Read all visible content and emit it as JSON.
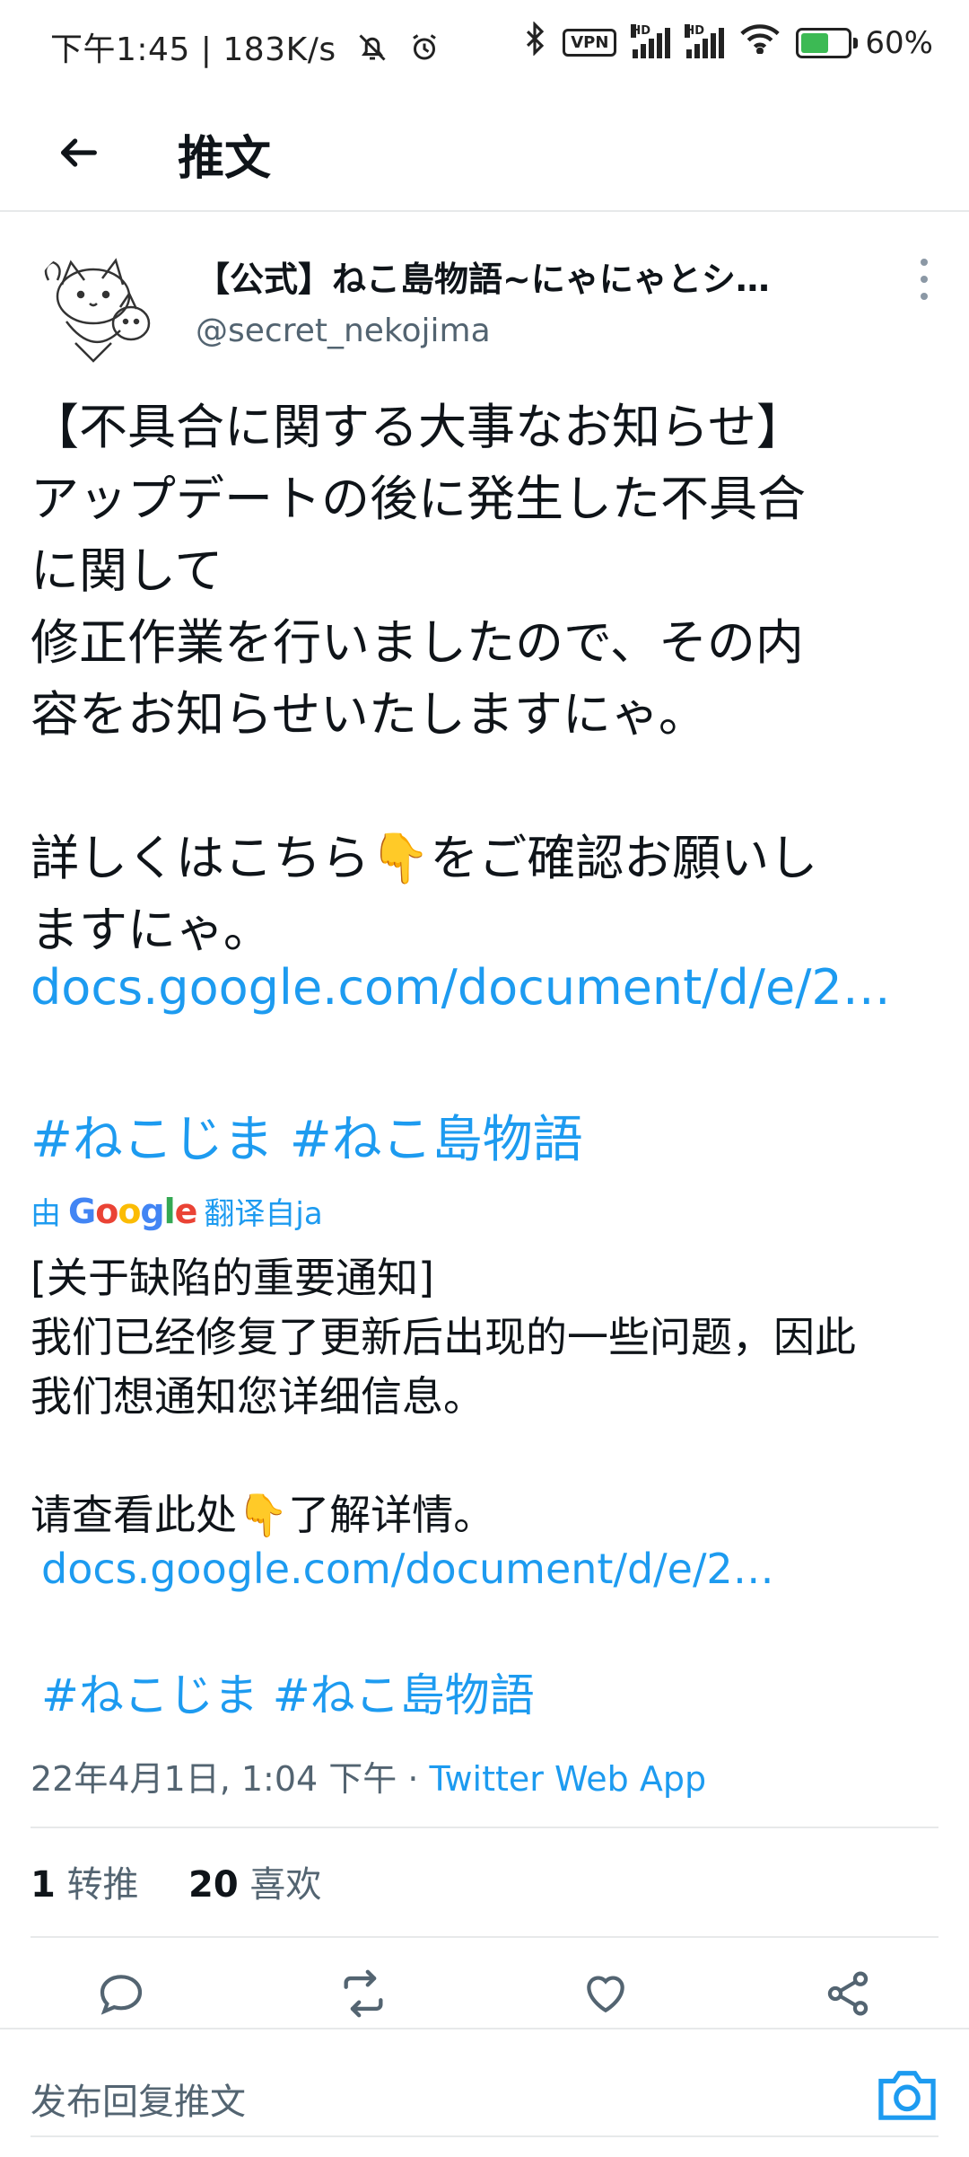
{
  "status_bar": {
    "time": "下午1:45",
    "speed": "183K/s",
    "vpn": "VPN",
    "battery": "60%",
    "battery_level": 0.6
  },
  "header": {
    "title": "推文"
  },
  "tweet": {
    "author_name": "【公式】ねこ島物語~にゃにゃとシ…",
    "author_handle": "@secret_nekojima",
    "text": "【不具合に関する大事なお知らせ】\nアップデートの後に発生した不具合\nに関して\n修正作業を行いましたので、その内\n容をお知らせいたしますにゃ。\n\n詳しくはこちら👇をご確認お願いし\nますにゃ。",
    "link": "docs.google.com/document/d/e/2…",
    "hashtags": "#ねこじま #ねこ島物語",
    "translated_prefix": "由",
    "translated_brand": "Google",
    "translated_suffix": "翻译自ja",
    "translation_text": "[关于缺陷的重要通知]\n我们已经修复了更新后出现的一些问题，因此\n我们想通知您详细信息。\n\n请查看此处👇了解详情。",
    "translation_link": "docs.google.com/document/d/e/2…",
    "translation_hashtags": "#ねこじま #ねこ島物語",
    "timestamp": "22年4月1日, 1:04 下午 · ",
    "source": "Twitter Web App",
    "retweets_count": "1",
    "retweets_label": "转推",
    "likes_count": "20",
    "likes_label": "喜欢"
  },
  "reply_bar": {
    "placeholder": "发布回复推文"
  },
  "colors": {
    "link": "#1d9bf0",
    "secondary_text": "#536471",
    "divider": "#e7e9ea"
  },
  "icons": [
    "back-arrow-icon",
    "more-vertical-icon",
    "reply-icon",
    "retweet-icon",
    "like-icon",
    "share-icon",
    "camera-icon"
  ]
}
